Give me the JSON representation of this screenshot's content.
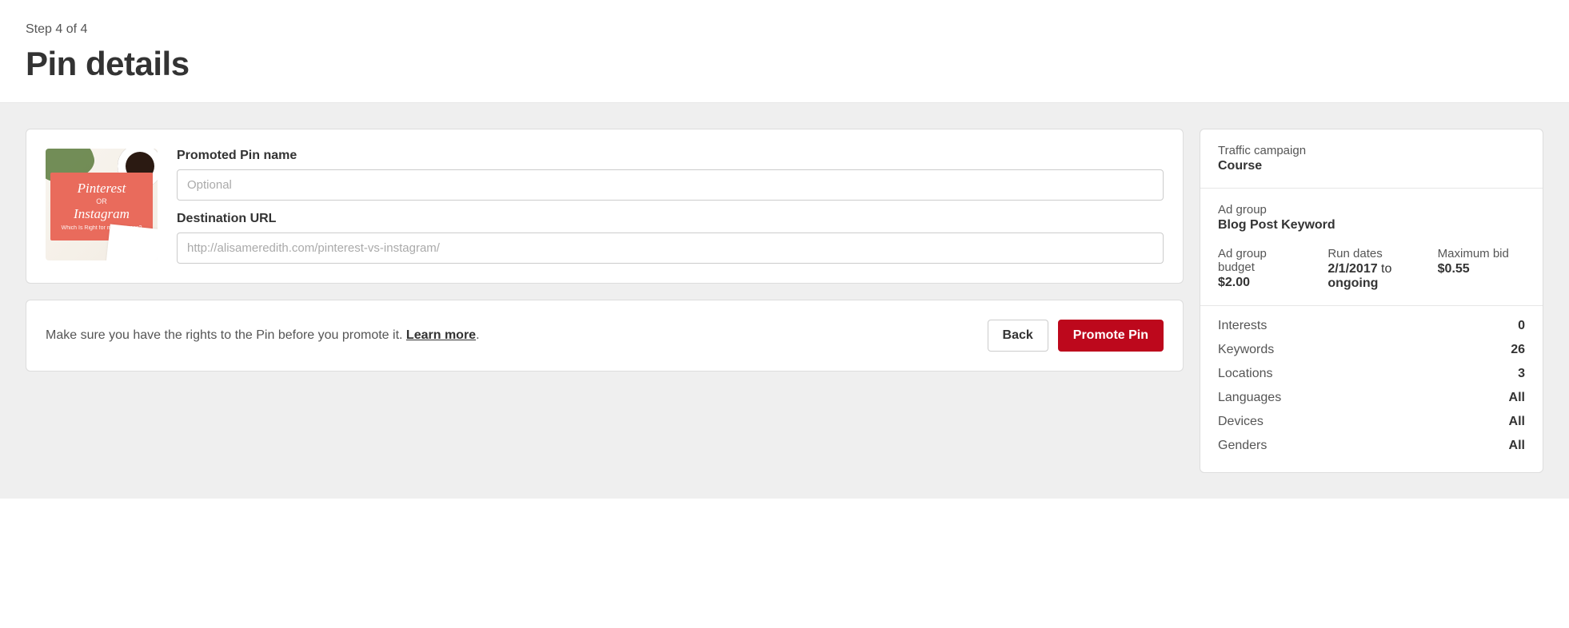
{
  "header": {
    "step": "Step 4 of 4",
    "title": "Pin details"
  },
  "thumb": {
    "line1": "Pinterest",
    "line2": "OR",
    "line3": "Instagram",
    "line4": "Which Is Right for my Business?"
  },
  "form": {
    "name_label": "Promoted Pin name",
    "name_placeholder": "Optional",
    "name_value": "",
    "url_label": "Destination URL",
    "url_placeholder": "http://alisameredith.com/pinterest-vs-instagram/",
    "url_value": ""
  },
  "actions": {
    "rights_text": "Make sure you have the rights to the Pin before you promote it. ",
    "learn_more": "Learn more",
    "period": ".",
    "back": "Back",
    "promote": "Promote Pin"
  },
  "sidebar": {
    "campaign_label": "Traffic campaign",
    "campaign_value": "Course",
    "adgroup_label": "Ad group",
    "adgroup_value": "Blog Post Keyword",
    "budget_label": "Ad group budget",
    "budget_value": "$2.00",
    "run_label": "Run dates",
    "run_date": "2/1/2017",
    "run_to": " to ",
    "run_ongoing": "ongoing",
    "bid_label": "Maximum bid",
    "bid_value": "$0.55",
    "stats": [
      {
        "label": "Interests",
        "value": "0"
      },
      {
        "label": "Keywords",
        "value": "26"
      },
      {
        "label": "Locations",
        "value": "3"
      },
      {
        "label": "Languages",
        "value": "All"
      },
      {
        "label": "Devices",
        "value": "All"
      },
      {
        "label": "Genders",
        "value": "All"
      }
    ]
  }
}
